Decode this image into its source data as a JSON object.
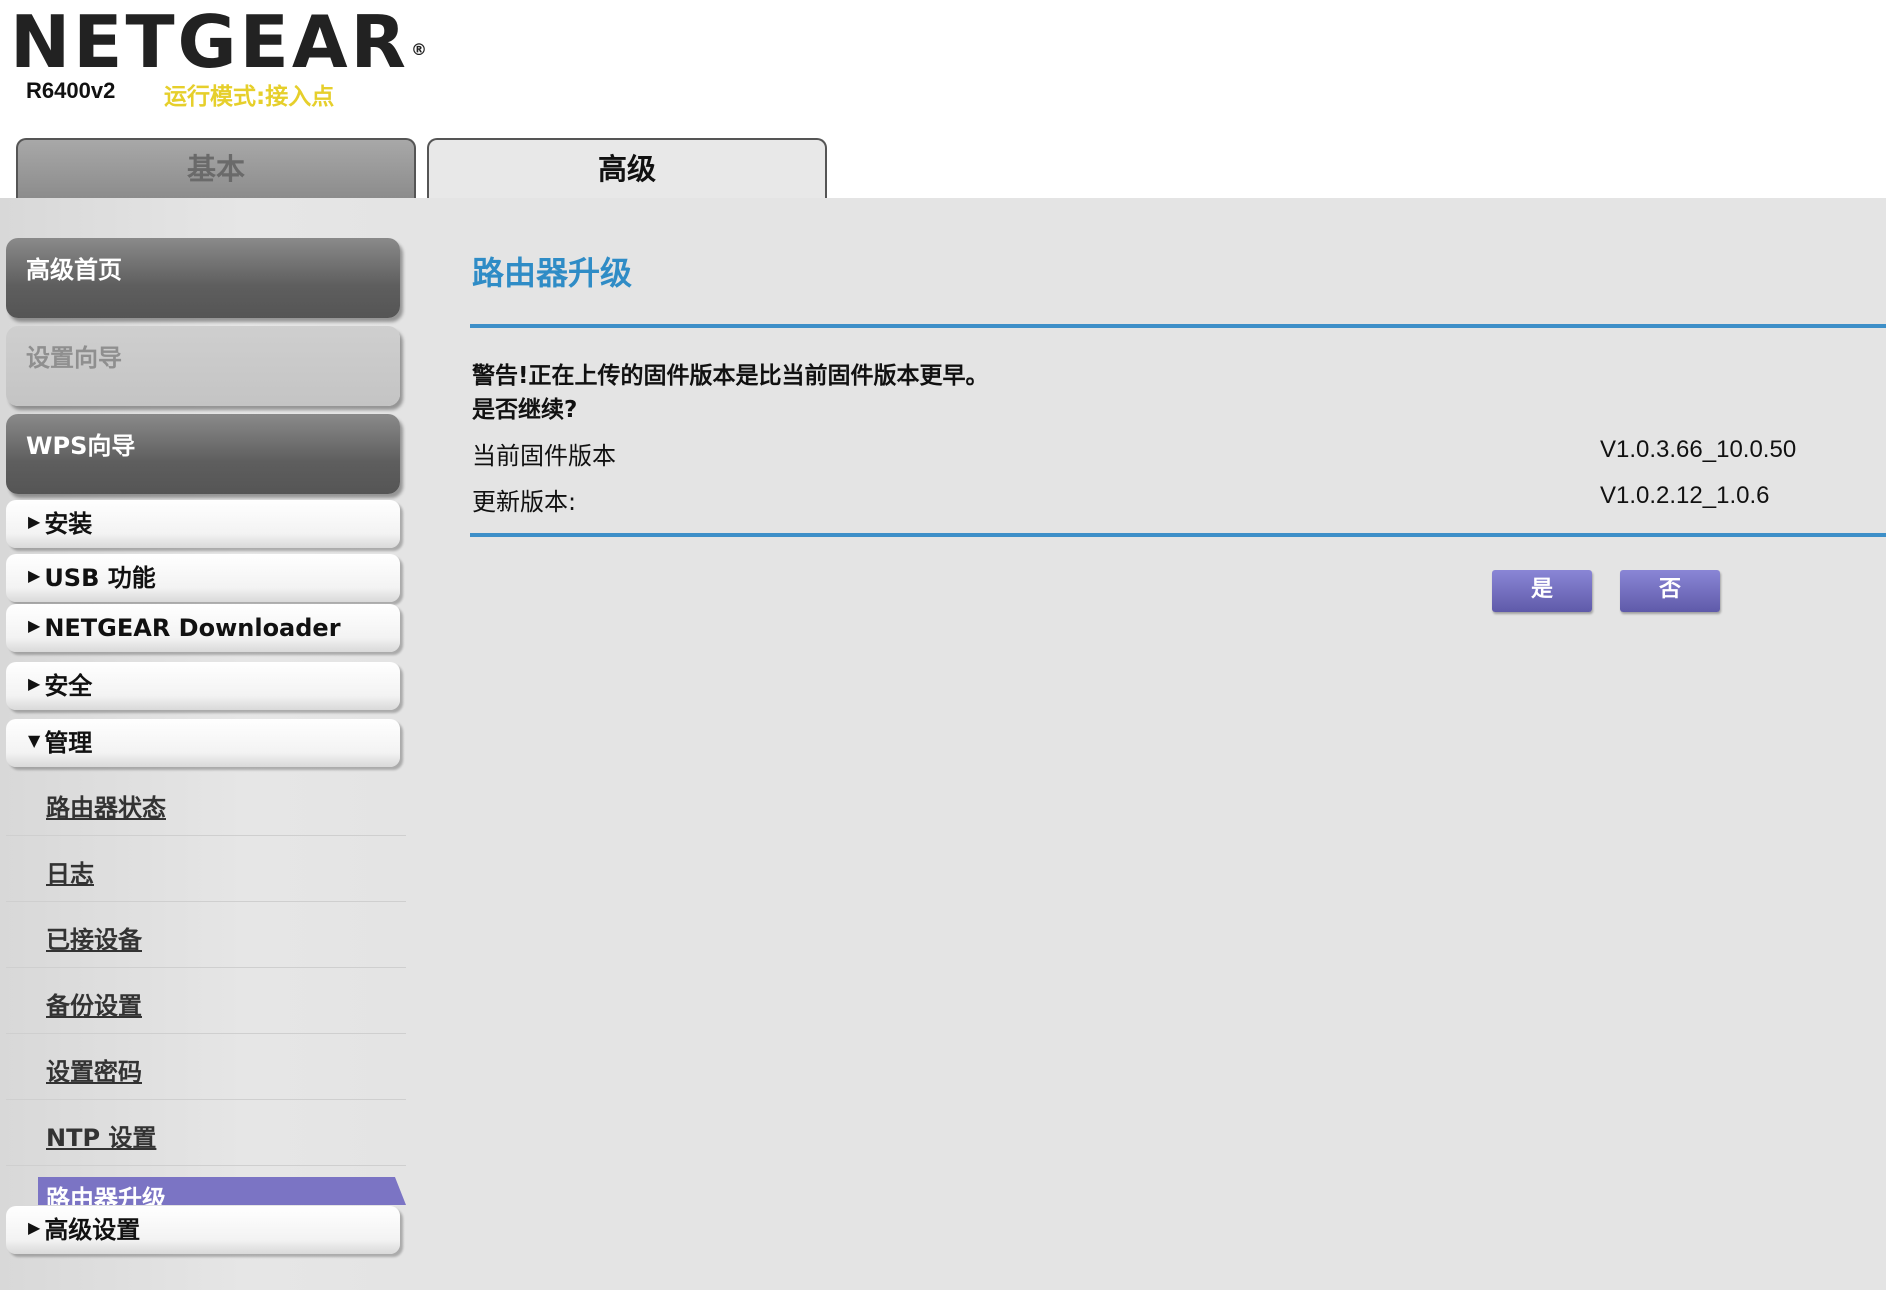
{
  "header": {
    "brand": "NETGEAR",
    "brand_mark": "®",
    "model": "R6400v2",
    "mode": "运行模式:接入点"
  },
  "tabs": [
    {
      "label": "基本",
      "active": false
    },
    {
      "label": "高级",
      "active": true
    }
  ],
  "sidebar": {
    "main_buttons": [
      "高级首页",
      "设置向导",
      "WPS向导"
    ],
    "sections": [
      "安装",
      "USB 功能",
      "NETGEAR Downloader",
      "安全",
      "管理",
      "高级设置"
    ],
    "sub_items": [
      "路由器状态",
      "日志",
      "已接设备",
      "备份设置",
      "设置密码",
      "NTP 设置"
    ],
    "active_item": "路由器升级"
  },
  "content": {
    "title": "路由器升级",
    "warning_line1": "警告!正在上传的固件版本是比当前固件版本更早。",
    "warning_line2": "是否继续?",
    "current_label": "当前固件版本",
    "current_value": "V1.0.3.66_10.0.50",
    "update_label": "更新版本:",
    "update_value": "V1.0.2.12_1.0.6",
    "yes_button": "是",
    "no_button": "否"
  },
  "colors": {
    "accent_title": "#2f8cc6",
    "button": "#6a65b6",
    "mode_text": "#e6cf2b"
  }
}
